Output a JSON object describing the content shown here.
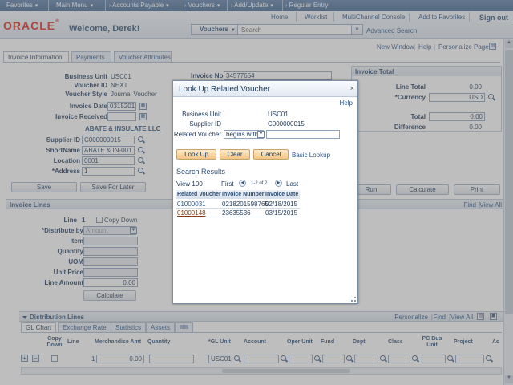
{
  "topbar": {
    "favorites": "Favorites",
    "main_menu": "Main Menu",
    "accounts_payable": "Accounts Payable",
    "vouchers": "Vouchers",
    "add_update": "Add/Update",
    "regular_entry": "Regular Entry"
  },
  "header": {
    "logo": "ORACLE",
    "welcome": "Welcome, Derek!",
    "links": {
      "home": "Home",
      "worklist": "Worklist",
      "multichannel": "MultiChannel Console",
      "add_favorites": "Add to Favorites",
      "sign_out": "Sign out"
    },
    "search": {
      "scope": "Vouchers",
      "placeholder": "Search",
      "go": "»",
      "advanced": "Advanced Search"
    }
  },
  "pagebar": {
    "new_window": "New Window",
    "help": "Help",
    "personalize": "Personalize Page"
  },
  "tabs": [
    "Invoice Information",
    "Payments",
    "Voucher Attributes"
  ],
  "form": {
    "business_unit": {
      "label": "Business Unit",
      "value": "USC01"
    },
    "voucher_id": {
      "label": "Voucher ID",
      "value": "NEXT"
    },
    "voucher_style": {
      "label": "Voucher Style",
      "value": "Journal Voucher"
    },
    "invoice_date": {
      "label": "Invoice Date",
      "value": "03152015"
    },
    "invoice_received": {
      "label": "Invoice Received",
      "value": ""
    },
    "invoice_no": {
      "label": "Invoice No",
      "value": "34577654"
    },
    "vendor_name": "ABATE & INSULATE LLC",
    "supplier_id": {
      "label": "Supplier ID",
      "value": "C000000015"
    },
    "short_name": {
      "label": "ShortName",
      "value": "ABATE & IN-001"
    },
    "location": {
      "label": "Location",
      "value": "0001"
    },
    "address": {
      "label": "*Address",
      "value": "1"
    }
  },
  "invoice_total": {
    "title": "Invoice Total",
    "line_total": {
      "label": "Line Total",
      "value": "0.00"
    },
    "currency": {
      "label": "*Currency",
      "value": "USD"
    },
    "total": {
      "label": "Total",
      "value": "0.00"
    },
    "difference": {
      "label": "Difference",
      "value": "0.00"
    }
  },
  "actions": {
    "save": "Save",
    "save_later": "Save For Later",
    "run": "Run",
    "calculate": "Calculate",
    "print": "Print"
  },
  "invoice_lines": {
    "title": "Invoice Lines",
    "find": "Find",
    "view_all": "View All",
    "line": {
      "label": "Line",
      "value": "1"
    },
    "copy_down": "Copy Down",
    "distribute_by": {
      "label": "*Distribute by",
      "value": "Amount"
    },
    "item": "Item",
    "quantity": "Quantity",
    "uom": "UOM",
    "unit_price": "Unit Price",
    "line_amount": {
      "label": "Line Amount",
      "value": "0.00"
    },
    "calculate": "Calculate"
  },
  "distribution": {
    "title": "Distribution Lines",
    "personalize": "Personalize",
    "find": "Find",
    "view_all": "View All",
    "tabs": [
      "GL Chart",
      "Exchange Rate",
      "Statistics",
      "Assets"
    ],
    "columns": [
      "Copy Down",
      "Line",
      "Merchandise Amt",
      "Quantity",
      "*GL Unit",
      "Account",
      "Oper Unit",
      "Fund",
      "Dept",
      "Class",
      "PC Bus Unit",
      "Project",
      "Ac"
    ],
    "row": {
      "line": "1",
      "amount": "0.00",
      "gl_unit": "USC01"
    }
  },
  "modal": {
    "title": "Look Up Related Voucher",
    "close": "×",
    "help": "Help",
    "business_unit": {
      "label": "Business Unit",
      "value": "USC01"
    },
    "supplier_id": {
      "label": "Supplier ID",
      "value": "C000000015"
    },
    "related_voucher": {
      "label": "Related Voucher",
      "operator": "begins with",
      "value": ""
    },
    "buttons": {
      "lookup": "Look Up",
      "clear": "Clear",
      "cancel": "Cancel",
      "basic_lookup": "Basic Lookup"
    },
    "results": {
      "title": "Search Results",
      "view": "View 100",
      "first": "First",
      "range": "1-2 of 2",
      "last": "Last",
      "columns": [
        "Related Voucher",
        "Invoice Number",
        "Invoice Date"
      ],
      "rows": [
        {
          "voucher": "01000031",
          "invoice": "0218201598765",
          "date": "02/18/2015"
        },
        {
          "voucher": "01000148",
          "invoice": "23635536",
          "date": "03/15/2015"
        }
      ]
    }
  }
}
